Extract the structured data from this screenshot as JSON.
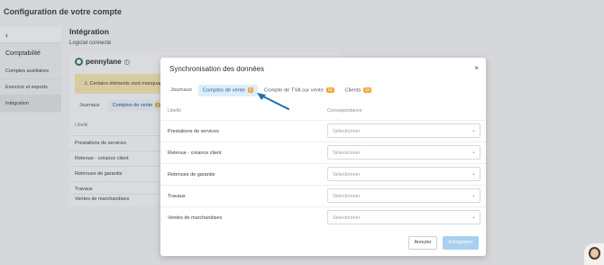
{
  "app_title": "Configuration de votre compte",
  "sidebar": {
    "back": "‹",
    "section": "Comptabilité",
    "items": [
      {
        "label": "Comptes auxiliaires"
      },
      {
        "label": "Exercice et exports"
      },
      {
        "label": "Intégration"
      }
    ]
  },
  "main": {
    "title": "Intégration",
    "subtitle": "Logiciel connecté",
    "logo_text": "pennylane",
    "warning": "Certains éléments sont manquan",
    "tabs": [
      {
        "label": "Journaux"
      },
      {
        "label": "Comptes de vente",
        "count": "5"
      }
    ],
    "column": "Libellé",
    "rows": [
      "Prestations de services",
      "Retenue - créance client",
      "Retenues de garantie",
      "Travaux",
      "Ventes de marchandises"
    ]
  },
  "modal": {
    "title": "Synchronisation des données",
    "close": "×",
    "tabs": [
      {
        "label": "Journaux",
        "count": ""
      },
      {
        "label": "Comptes de vente",
        "count": "5"
      },
      {
        "label": "Compte de TVA sur vente",
        "count": "10"
      },
      {
        "label": "Clients",
        "count": "18"
      }
    ],
    "columns": {
      "label": "Libellé",
      "mapping": "Correspondance"
    },
    "rows": [
      {
        "label": "Prestations de services",
        "select": "Sélectionner"
      },
      {
        "label": "Retenue - créance client",
        "select": "Sélectionner"
      },
      {
        "label": "Retenues de garantie",
        "select": "Sélectionner"
      },
      {
        "label": "Travaux",
        "select": "Sélectionner"
      },
      {
        "label": "Ventes de marchandises",
        "select": "Sélectionner"
      }
    ],
    "cancel": "Annuler",
    "save": "Enregistrer"
  },
  "colors": {
    "accent": "#dbeefb",
    "badge": "#f0a63c",
    "save": "#a9d0ef",
    "arrow": "#1f6fb5"
  }
}
